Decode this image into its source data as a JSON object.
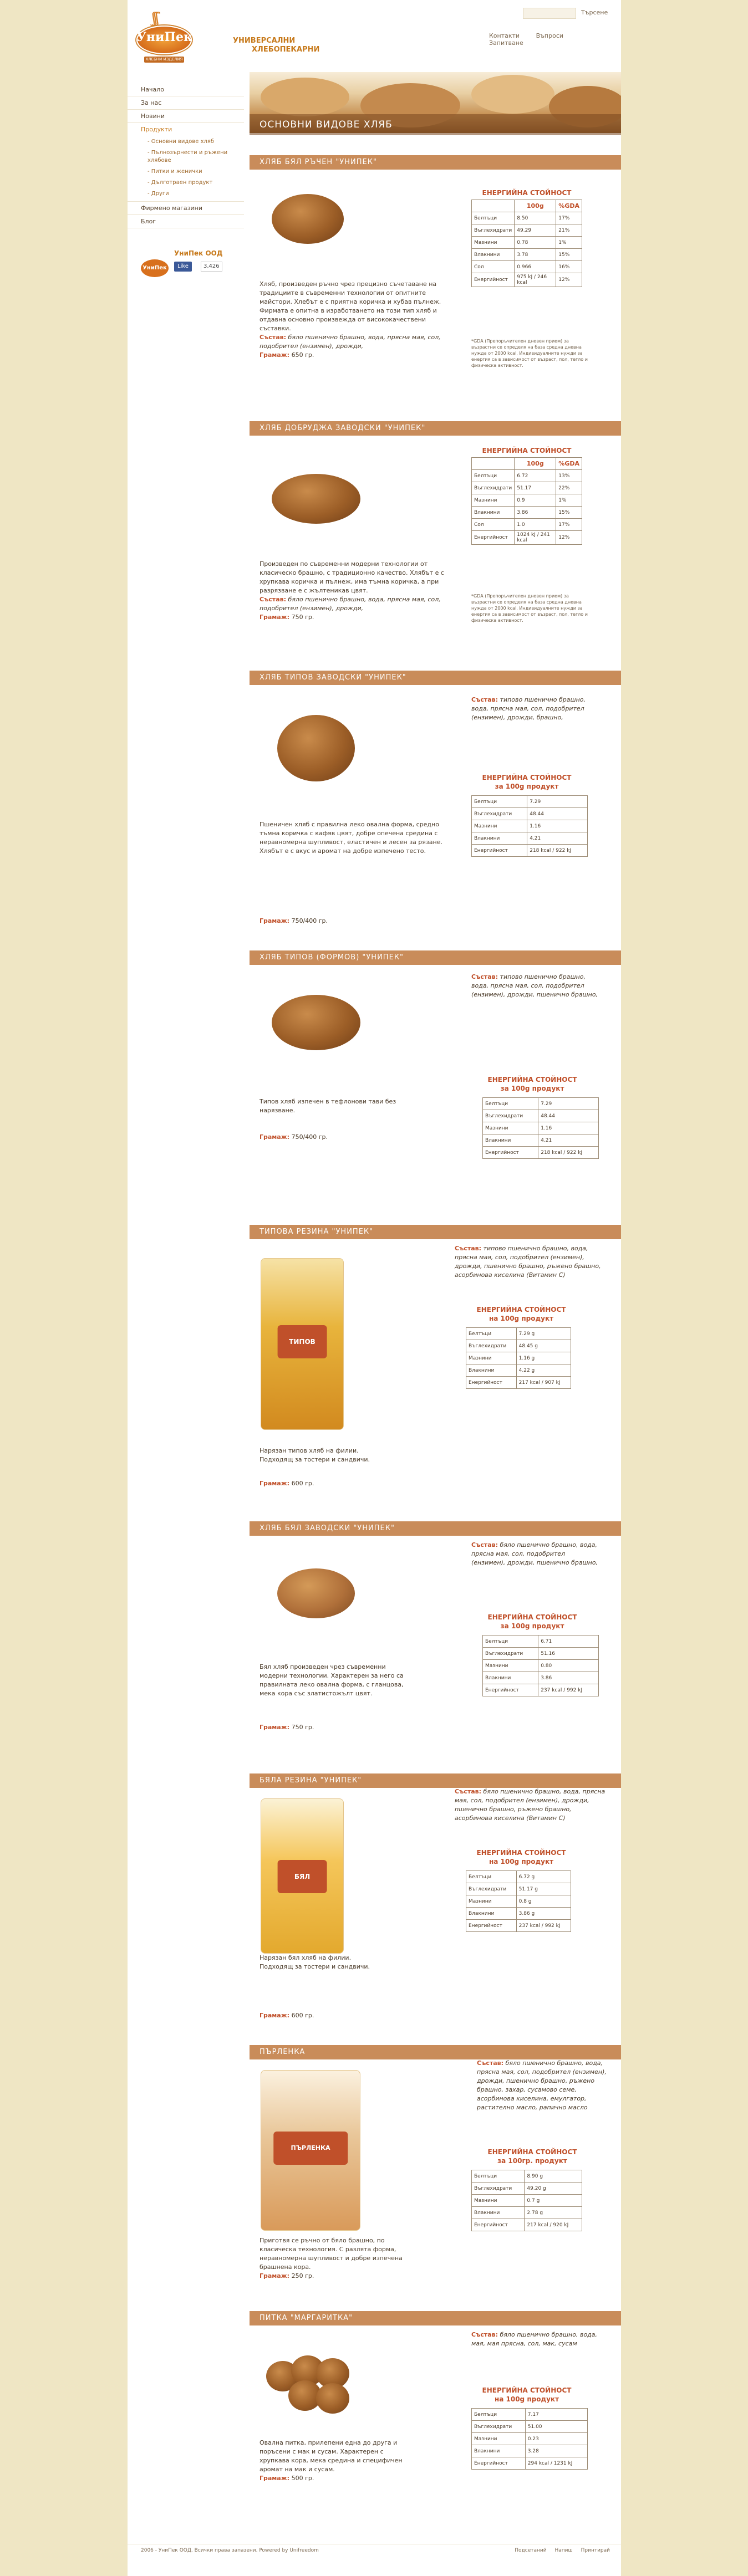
{
  "header": {
    "logo_word": "УниПек",
    "logo_tag": "ХЛЕБНИ ИЗДЕЛИЯ",
    "tagline_1": "УНИВЕРСАЛНИ",
    "tagline_2": "ХЛЕБОПЕКАРНИ",
    "search_label": "Търсене",
    "nav": [
      "Контакти",
      "Въпроси",
      "Запитване"
    ]
  },
  "page_title": "ОСНОВНИ ВИДОВЕ ХЛЯБ",
  "sidebar": {
    "items": [
      {
        "label": "Начало"
      },
      {
        "label": "За нас"
      },
      {
        "label": "Новини"
      },
      {
        "label": "Продукти"
      }
    ],
    "subitems": [
      "- Основни видове хляб",
      "- Пълнозърнести и ръжени хлябове",
      "- Питки и женички",
      "- Дълготраен продукт",
      "- Други"
    ],
    "items2": [
      {
        "label": "Фирмено магазини"
      },
      {
        "label": "Блог"
      }
    ],
    "company": "УниПек ООД",
    "fb_like": "Like",
    "fb_count": "3,426"
  },
  "products": [
    {
      "title": "ХЛЯБ БЯЛ РЪЧЕН \"УНИПЕК\"",
      "desc": "Хляб, произведен ръчно чрез прецизно съчетаване на традициите в съвременни технологии от опитните майстори. Хлебът е с приятна коричка и хубав пълнеж. Фирмата е опитна в изработването на този тип хляб и отдавна основно произвежда от висококачествени съставки.",
      "composition_label": "Състав:",
      "composition": "бяло пшенично брашно, вода, прясна мая, сол, подобрител (ензимен), дрожди,",
      "grams_label": "Грамаж:",
      "grams": "650 гр.",
      "energy_title": "ЕНЕРГИЙНА СТОЙНОСТ",
      "col_a": "100g",
      "col_b": "%GDA",
      "rows": [
        [
          "Белтъци",
          "8.50",
          "17%"
        ],
        [
          "Въглехидрати",
          "49.29",
          "21%"
        ],
        [
          "Мазнини",
          "0.78",
          "1%"
        ],
        [
          "Влакнини",
          "3.78",
          "15%"
        ],
        [
          "Сол",
          "0.966",
          "16%"
        ],
        [
          "Енергийност",
          "975 kJ / 246 kcal",
          "12%"
        ]
      ],
      "note": "*GDA (Препоръчителен дневен прием) за възрастни се определя на база средна дневна нужда от 2000 kcal. Индивидуалните нужди за енергия са в зависимост от възраст, пол, тегло и физическа активност."
    },
    {
      "title": "ХЛЯБ ДОБРУДЖА ЗАВОДСКИ \"УНИПЕК\"",
      "desc": "Произведен по съвременни модерни технологии от класическо брашно, с традиционно качество. Хлябът е с хрупкава коричка и пълнеж, има тъмна коричка, а при разрязване е с жълтеникав цвят.",
      "composition_label": "Състав:",
      "composition": "бяло пшенично брашно, вода, прясна мая, сол, подобрител (ензимен), дрожди,",
      "grams_label": "Грамаж:",
      "grams": "750 гр.",
      "energy_title": "ЕНЕРГИЙНА СТОЙНОСТ",
      "col_a": "100g",
      "col_b": "%GDA",
      "rows": [
        [
          "Белтъци",
          "6.72",
          "13%"
        ],
        [
          "Въглехидрати",
          "51.17",
          "22%"
        ],
        [
          "Мазнини",
          "0.9",
          "1%"
        ],
        [
          "Влакнини",
          "3.86",
          "15%"
        ],
        [
          "Сол",
          "1.0",
          "17%"
        ],
        [
          "Енергийност",
          "1024 kJ / 241 kcal",
          "12%"
        ]
      ],
      "note": "*GDA (Препоръчителен дневен прием) за възрастни се определя на база средна дневна нужда от 2000 kcal. Индивидуалните нужди за енергия са в зависимост от възраст, пол, тегло и физическа активност."
    },
    {
      "title": "ХЛЯБ ТИПОВ ЗАВОДСКИ \"УНИПЕК\"",
      "desc": "Пшеничен хляб с правилна леко овална форма, средно тъмна коричка с кафяв цвят, добре опечена средина с неравномерна шупливост, еластичен и лесен за рязане. Хлябът е с вкус и аромат на добре изпечено тесто.",
      "composition_label": "Състав:",
      "composition": "типово пшенично брашно, вода, прясна мая, сол, подобрител (ензимен), дрожди, брашно,",
      "grams_label": "Грамаж:",
      "grams": "750/400 гр.",
      "energy_title": "ЕНЕРГИЙНА СТОЙНОСТ",
      "energy_sub": "за 100g продукт",
      "rows": [
        [
          "Белтъци",
          "7.29"
        ],
        [
          "Въглехидрати",
          "48.44"
        ],
        [
          "Мазнини",
          "1.16"
        ],
        [
          "Влакнини",
          "4.21"
        ],
        [
          "Енергийност",
          "218 kcal / 922 kJ"
        ]
      ]
    },
    {
      "title": "ХЛЯБ ТИПОВ (ФОРМОВ) \"УНИПЕК\"",
      "desc": "Типов хляб изпечен в тефлонови тави без нарязване.",
      "composition_label": "Състав:",
      "composition": "типово пшенично брашно, вода, прясна мая, сол, подобрител (ензимен), дрожди, пшенично брашно,",
      "grams_label": "Грамаж:",
      "grams": "750/400 гр.",
      "energy_title": "ЕНЕРГИЙНА СТОЙНОСТ",
      "energy_sub": "за 100g продукт",
      "rows": [
        [
          "Белтъци",
          "7.29"
        ],
        [
          "Въглехидрати",
          "48.44"
        ],
        [
          "Мазнини",
          "1.16"
        ],
        [
          "Влакнини",
          "4.21"
        ],
        [
          "Енергийност",
          "218 kcal / 922 kJ"
        ]
      ]
    },
    {
      "title": "ТИПОВА РЕЗИНА \"УНИПЕК\"",
      "desc": "Нарязан типов хляб на филии. Подходящ за тостери и сандвичи.",
      "composition_label": "Състав:",
      "composition": "типово пшенично брашно, вода, прясна мая, сол, подобрител (ензимен), дрожди, пшенично брашно, ръжено брашно, асорбинова киселина (Витамин С)",
      "grams_label": "Грамаж:",
      "grams": "600 гр.",
      "energy_title": "ЕНЕРГИЙНА СТОЙНОСТ",
      "energy_sub": "на 100g продукт",
      "bag_label": "ТИПОВ",
      "rows": [
        [
          "Белтъци",
          "7.29 g"
        ],
        [
          "Въглехидрати",
          "48.45 g"
        ],
        [
          "Мазнини",
          "1.16 g"
        ],
        [
          "Влакнини",
          "4.22 g"
        ],
        [
          "Енергийност",
          "217 kcal / 907 kJ"
        ]
      ]
    },
    {
      "title": "ХЛЯБ БЯЛ ЗАВОДСКИ \"УНИПЕК\"",
      "desc": "Бял хляб произведен чрез съвременни модерни технологии. Характерен за него са правилната леко овална форма, с гланцова, мека кора със златистожълт цвят.",
      "composition_label": "Състав:",
      "composition": "бяло пшенично брашно, вода, прясна мая, сол, подобрител (ензимен), дрожди, пшенично брашно,",
      "grams_label": "Грамаж:",
      "grams": "750 гр.",
      "energy_title": "ЕНЕРГИЙНА СТОЙНОСТ",
      "energy_sub": "за 100g продукт",
      "rows": [
        [
          "Белтъци",
          "6.71"
        ],
        [
          "Въглехидрати",
          "51.16"
        ],
        [
          "Мазнини",
          "0.80"
        ],
        [
          "Влакнини",
          "3.86"
        ],
        [
          "Енергийност",
          "237 kcal / 992 kJ"
        ]
      ]
    },
    {
      "title": "БЯЛА РЕЗИНА \"УНИПЕК\"",
      "desc": "Нарязан бял хляб на филии. Подходящ за тостери и сандвичи.",
      "composition_label": "Състав:",
      "composition": "бяло пшенично брашно, вода, прясна мая, сол, подобрител (ензимен), дрожди, пшенично брашно, ръжено брашно, асорбинова киселина (Витамин С)",
      "grams_label": "Грамаж:",
      "grams": "600 гр.",
      "energy_title": "ЕНЕРГИЙНА СТОЙНОСТ",
      "energy_sub": "на 100g продукт",
      "bag_label": "БЯЛ",
      "rows": [
        [
          "Белтъци",
          "6.72 g"
        ],
        [
          "Въглехидрати",
          "51.17 g"
        ],
        [
          "Мазнини",
          "0.8 g"
        ],
        [
          "Влакнини",
          "3.86 g"
        ],
        [
          "Енергийност",
          "237 kcal / 992 kJ"
        ]
      ]
    },
    {
      "title": "ПЪРЛЕНКА",
      "desc": "Приготвя се ръчно от бяло брашно, по класическа технология. С разлята форма, неравномерна шупливост и добре изпечена брашнена кора.",
      "composition_label": "Състав:",
      "composition": "бяло пшенично брашно, вода, прясна мая, сол, подобрител (ензимен), дрожди, пшенично брашно, ръжено брашно, захар, сусамово семе, асорбинова киселина, емулгатор, растително масло, рапично масло",
      "grams_label": "Грамаж:",
      "grams": "250 гр.",
      "energy_title": "ЕНЕРГИЙНА СТОЙНОСТ",
      "energy_sub": "за 100гр. продукт",
      "bag_label": "ПЪРЛЕНКА",
      "rows": [
        [
          "Белтъци",
          "8.90 g"
        ],
        [
          "Въглехидрати",
          "49.20 g"
        ],
        [
          "Мазнини",
          "0.7 g"
        ],
        [
          "Влакнини",
          "2.78 g"
        ],
        [
          "Енергийност",
          "217 kcal / 920 kJ"
        ]
      ]
    },
    {
      "title": "ПИТКА \"МАРГАРИТКА\"",
      "desc": "Овална питка, прилепени една до друга и поръсени с мак и сусам. Характерен с хрупкава кора, мека средина и специфичен аромат на мак и сусам.",
      "composition_label": "Състав:",
      "composition": "бяло пшенично брашно, вода, мая, мая прясна, сол, мак, сусам",
      "grams_label": "Грамаж:",
      "grams": "500 гр.",
      "energy_title": "ЕНЕРГИЙНА СТОЙНОСТ",
      "energy_sub": "на 100g продукт",
      "rows": [
        [
          "Белтъци",
          "7.17"
        ],
        [
          "Въглехидрати",
          "51.00"
        ],
        [
          "Мазнини",
          "0.23"
        ],
        [
          "Влакнини",
          "3.28"
        ],
        [
          "Енергийност",
          "294 kcal / 1231 kJ"
        ]
      ]
    }
  ],
  "footer": {
    "copyright": "2006 - УниПек ООД. Всички права запазени.   Powered by Unifreedom",
    "links": [
      "Подсетаний",
      "Напиш",
      "Принтирай"
    ]
  },
  "colors": {
    "background": "#efe6c4",
    "accent": "#c77a1c",
    "title_bar": "#c98c5a",
    "label_red": "#c0502a"
  }
}
